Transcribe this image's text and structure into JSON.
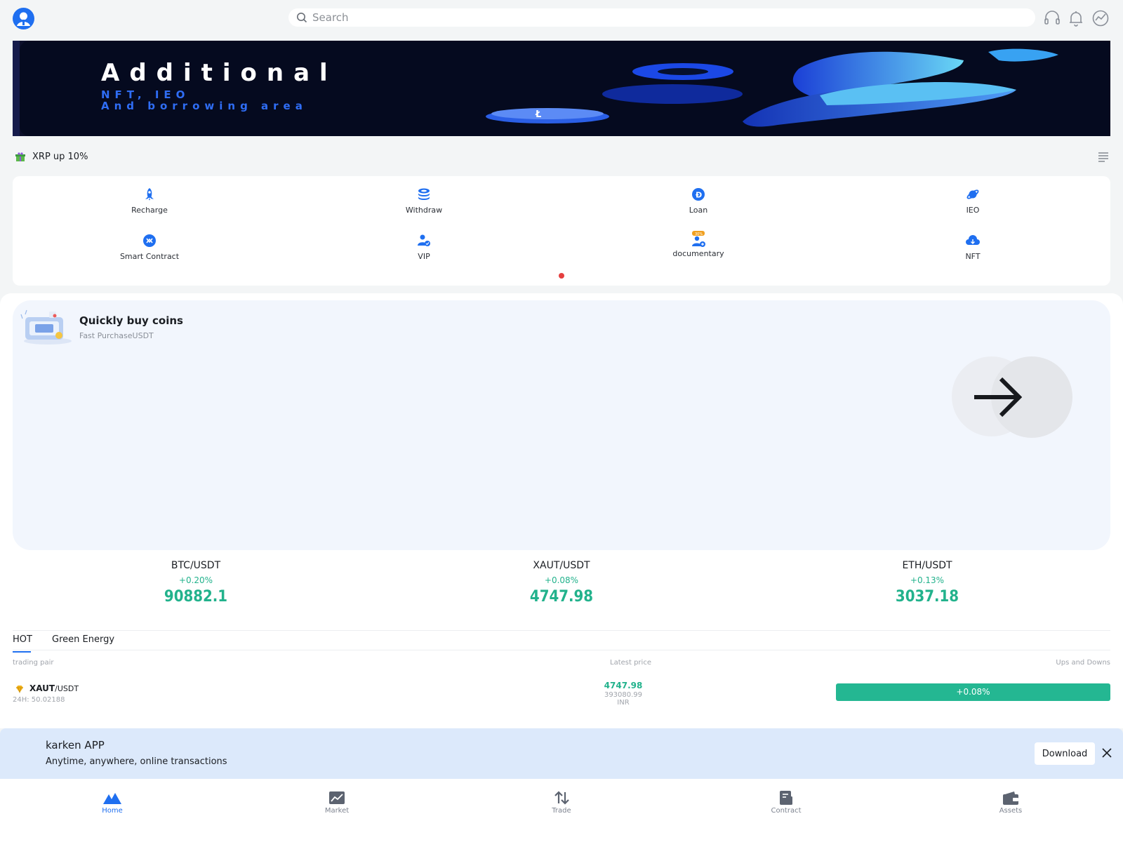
{
  "header": {
    "search_placeholder": "Search"
  },
  "banner": {
    "title": "Additional",
    "line1": "NFT, IEO",
    "line2": "And borrowing area"
  },
  "notice": {
    "text": "XRP up 10%"
  },
  "quick_menu": {
    "items": [
      {
        "label": "Recharge",
        "icon": "rocket-icon"
      },
      {
        "label": "Withdraw",
        "icon": "coins-stack-icon"
      },
      {
        "label": "Loan",
        "icon": "dogecoin-icon"
      },
      {
        "label": "IEO",
        "icon": "planet-icon"
      },
      {
        "label": "Smart Contract",
        "icon": "contract-icon"
      },
      {
        "label": "VIP",
        "icon": "vip-user-icon"
      },
      {
        "label": "documentary",
        "icon": "copy-trade-icon",
        "badge": "30%"
      },
      {
        "label": "NFT",
        "icon": "nft-cloud-icon"
      }
    ]
  },
  "buy_card": {
    "title": "Quickly buy coins",
    "subtitle": "Fast PurchaseUSDT"
  },
  "tickers": [
    {
      "pair": "BTC/USDT",
      "change": "+0.20%",
      "price": "90882.1"
    },
    {
      "pair": "XAUT/USDT",
      "change": "+0.08%",
      "price": "4747.98"
    },
    {
      "pair": "ETH/USDT",
      "change": "+0.13%",
      "price": "3037.18"
    }
  ],
  "tabs": {
    "hot": "HOT",
    "green": "Green Energy"
  },
  "table": {
    "col_pair": "trading pair",
    "col_price": "Latest price",
    "col_change": "Ups and Downs",
    "rows": [
      {
        "base": "XAUT",
        "quote": "/USDT",
        "volume": "24H: 50.02188",
        "price": "4747.98",
        "price_local": "393080.99",
        "currency": "INR",
        "change": "+0.08%"
      }
    ]
  },
  "app_banner": {
    "title": "karken APP",
    "subtitle": "Anytime, anywhere, online transactions",
    "download": "Download"
  },
  "bottom_nav": {
    "items": [
      {
        "label": "Home",
        "active": true
      },
      {
        "label": "Market",
        "active": false
      },
      {
        "label": "Trade",
        "active": false
      },
      {
        "label": "Contract",
        "active": false
      },
      {
        "label": "Assets",
        "active": false
      }
    ]
  },
  "colors": {
    "accent": "#1f6ff0",
    "up_green": "#22b28c",
    "badge_green": "#24b792",
    "notice_dot": "#e53f3f"
  }
}
